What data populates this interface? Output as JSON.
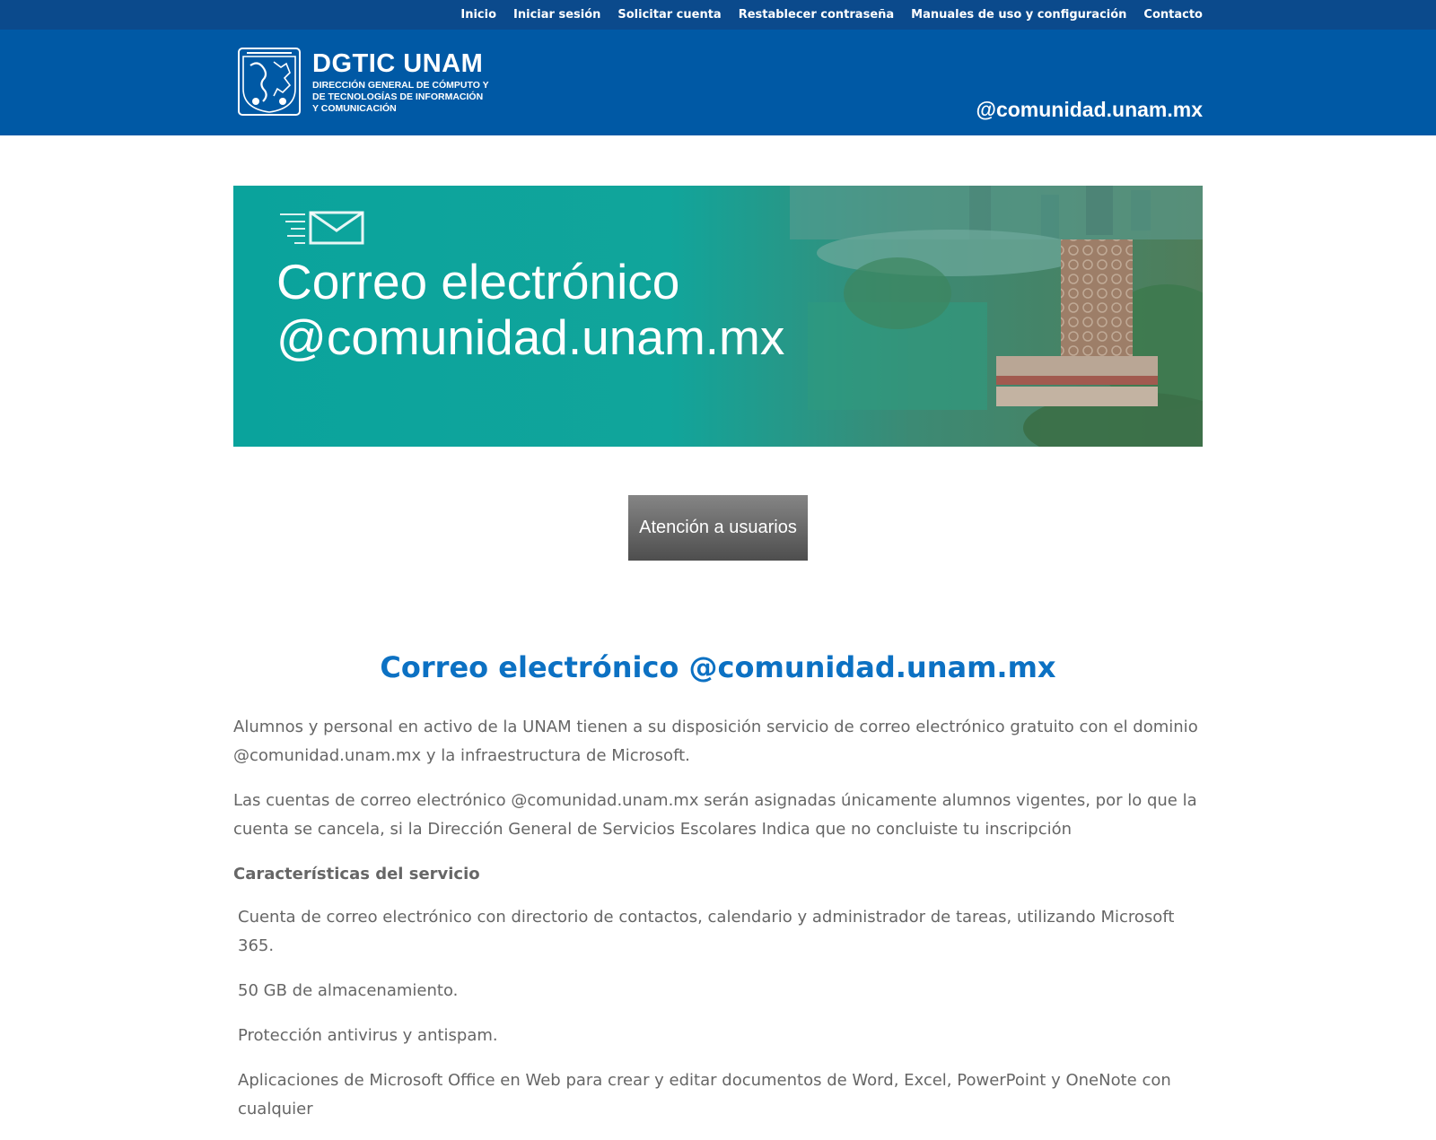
{
  "topnav": {
    "items": [
      "Inicio",
      "Iniciar sesión",
      "Solicitar cuenta",
      "Restablecer contraseña",
      "Manuales de uso y configuración",
      "Contacto"
    ]
  },
  "header": {
    "logo_title": "DGTIC UNAM",
    "logo_sub_1": "DIRECCIÓN GENERAL DE CÓMPUTO Y",
    "logo_sub_2": "DE TECNOLOGÍAS DE INFORMACIÓN",
    "logo_sub_3": "Y COMUNICACIÓN",
    "domain": "@comunidad.unam.mx"
  },
  "banner": {
    "line1": "Correo electrónico",
    "line2": "@comunidad.unam.mx",
    "icon": "envelope-icon"
  },
  "support_button": "Atención a usuarios",
  "main": {
    "title": "Correo electrónico @comunidad.unam.mx",
    "paragraph1": "Alumnos y personal en activo de la UNAM tienen a su disposición servicio de correo electrónico gratuito con el dominio @comunidad.unam.mx y la infraestructura de Microsoft.",
    "paragraph2": "Las cuentas de correo electrónico @comunidad.unam.mx serán asignadas únicamente alumnos vigentes, por lo que la cuenta se cancela, si la Dirección General de Servicios Escolares Indica que no concluiste tu inscripción",
    "features_heading": "Características del servicio",
    "features": [
      "Cuenta de correo electrónico con directorio de contactos, calendario y administrador de tareas, utilizando Microsoft 365.",
      "50 GB de almacenamiento.",
      "Protección antivirus y antispam.",
      "Aplicaciones de Microsoft Office en Web para crear y editar documentos de Word, Excel, PowerPoint y OneNote con cualquier"
    ]
  },
  "colors": {
    "topbar": "#0b4a8c",
    "header": "#0059a5",
    "title": "#0c71c3",
    "banner_teal": "#0aa39c"
  }
}
